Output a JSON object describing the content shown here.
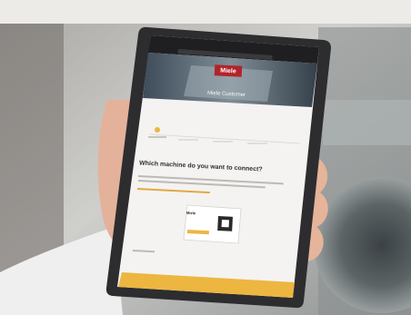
{
  "scene": {
    "description": "A hand holds a tablet displaying a web page with a product registration form.",
    "colors": {
      "background": "#b9b9b6",
      "tablet_frame": "#2d2d30",
      "page": "#f4f3f1",
      "accent": "#ecb640",
      "brand": "#b3232a",
      "skin": "#e8b79d",
      "sleeve": "#f0f0f0"
    }
  },
  "screen": {
    "brand": "Miele",
    "hero_title": "Miele Customer",
    "question": "Which machine do you want to connect?",
    "card_brand": "Miele"
  }
}
